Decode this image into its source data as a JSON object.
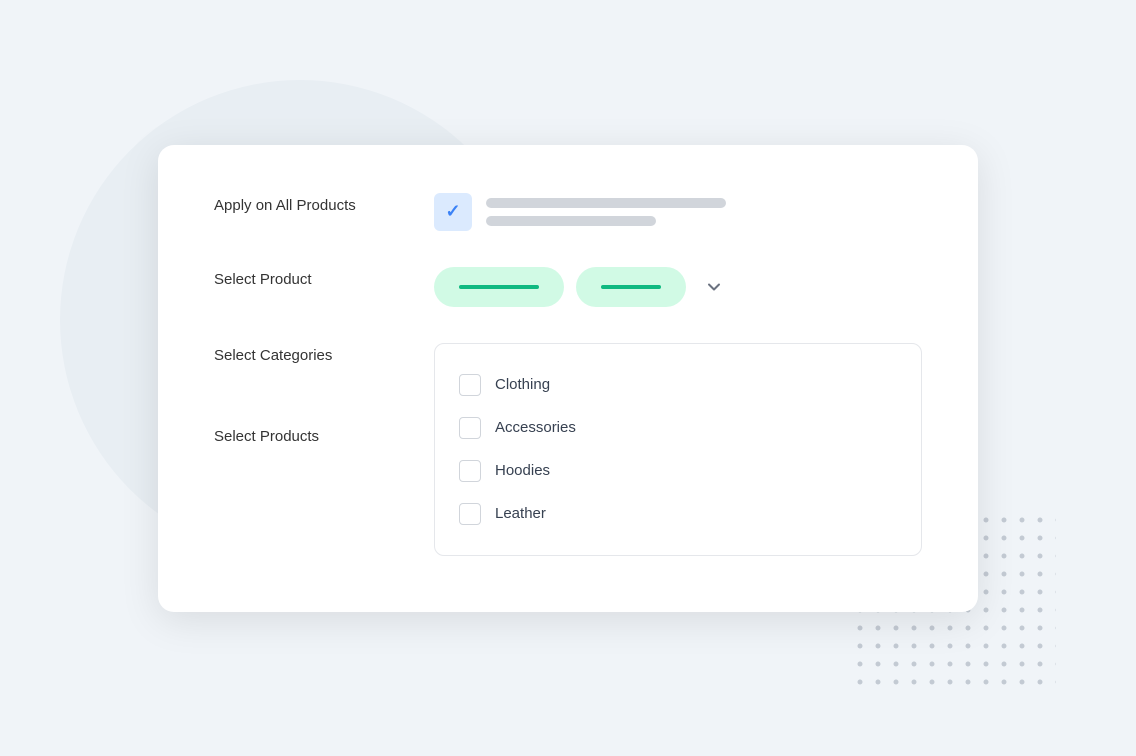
{
  "background": {
    "circle_color": "#e8eef3",
    "dots_color": "#c0c8d0"
  },
  "card": {
    "rows": [
      {
        "id": "apply-all",
        "label": "Apply on All Products",
        "type": "checkbox_with_lines",
        "checked": true
      },
      {
        "id": "select-product",
        "label": "Select Product",
        "type": "pills"
      },
      {
        "id": "select-categories",
        "label": "Select Categories",
        "type": "category_list"
      },
      {
        "id": "select-products",
        "label": "Select Products",
        "type": "spacer"
      }
    ],
    "categories": [
      {
        "id": "clothing",
        "label": "Clothing",
        "checked": false
      },
      {
        "id": "accessories",
        "label": "Accessories",
        "checked": false
      },
      {
        "id": "hoodies",
        "label": "Hoodies",
        "checked": false
      },
      {
        "id": "leather",
        "label": "Leather",
        "checked": false
      }
    ]
  }
}
